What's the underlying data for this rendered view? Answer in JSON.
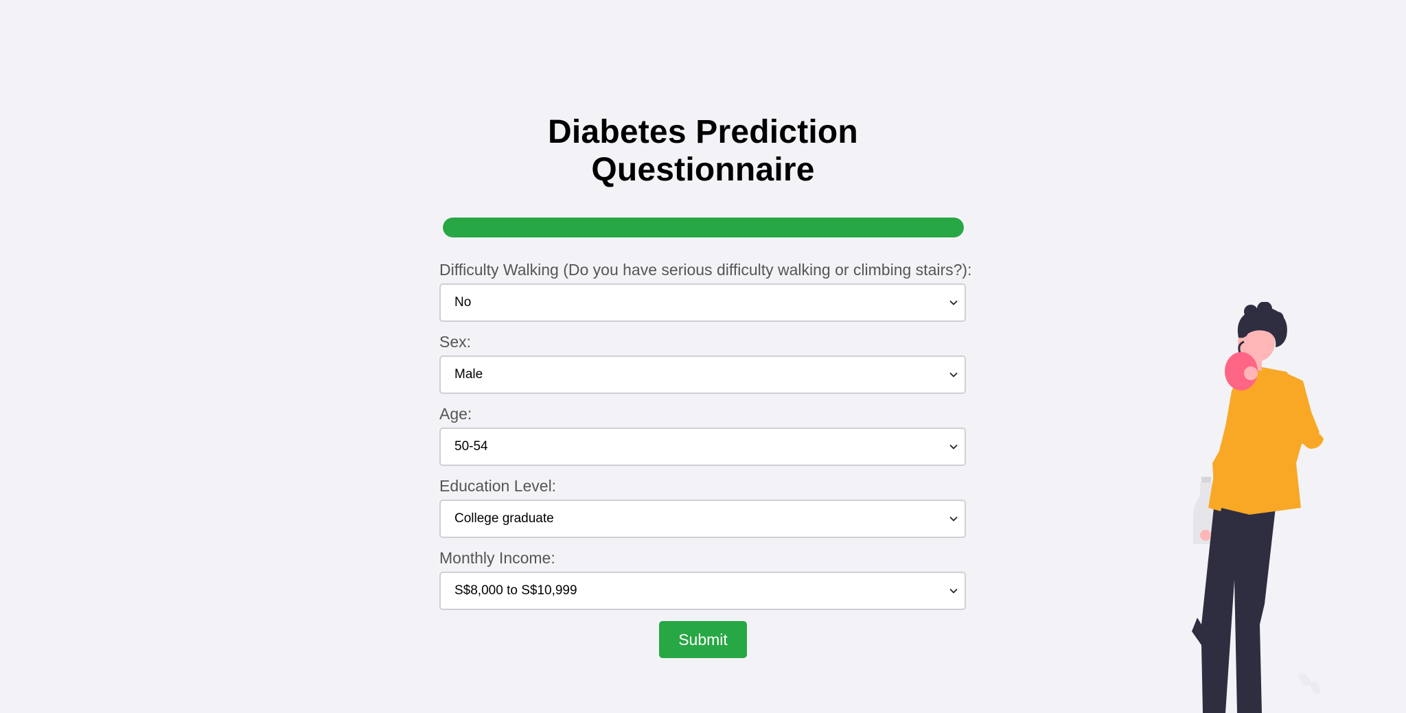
{
  "title": "Diabetes Prediction Questionnaire",
  "progress": {
    "fraction": 1.0
  },
  "colors": {
    "accent": "#28a745",
    "shirt": "#f9a826",
    "pants": "#2f2e41",
    "skin": "#ffb6b6",
    "apple": "#ff6584",
    "background": "#f3f3f7"
  },
  "fields": [
    {
      "label": "Difficulty Walking (Do you have serious difficulty walking or climbing stairs?):",
      "value": "No"
    },
    {
      "label": "Sex:",
      "value": "Male"
    },
    {
      "label": "Age:",
      "value": "50-54"
    },
    {
      "label": "Education Level:",
      "value": "College graduate"
    },
    {
      "label": "Monthly Income:",
      "value": "S$8,000 to S$10,999"
    }
  ],
  "submit_label": "Submit",
  "icons": {
    "select_arrow": "chevron-down-icon",
    "illustration": "person-eating-apple-illustration"
  }
}
